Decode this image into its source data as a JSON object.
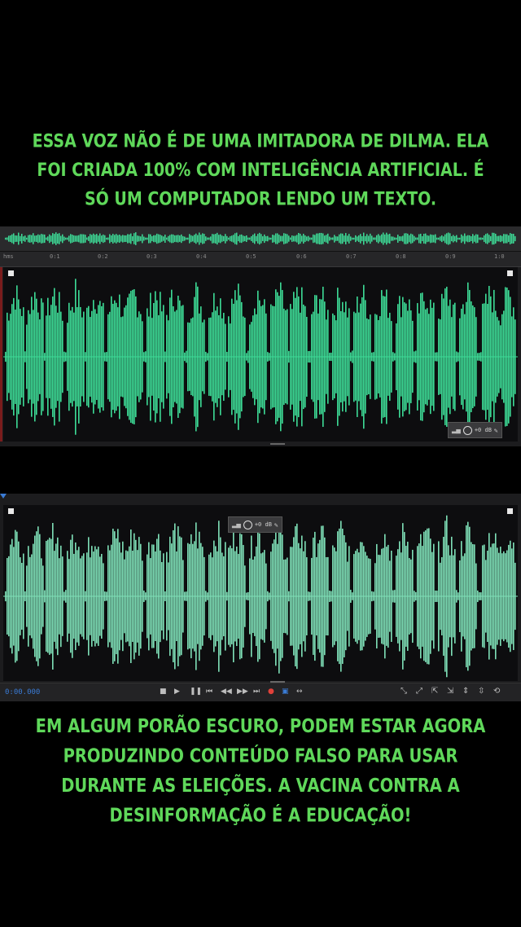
{
  "captions": {
    "top": [
      "ESSA VOZ NÃO É DE UMA IMITADORA DE DILMA. ELA",
      "FOI CRIADA 100% COM INTELIGÊNCIA ARTIFICIAL. É",
      "SÓ UM COMPUTADOR LENDO UM TEXTO."
    ],
    "bottom": [
      "EM ALGUM PORÃO ESCURO, PODEM ESTAR AGORA",
      "PRODUZINDO CONTEÚDO FALSO PARA USAR",
      "DURANTE AS ELEIÇÕES. A VACINA CONTRA A",
      "DESINFORMAÇÃO É A EDUCAÇÃO!"
    ]
  },
  "ruler_ticks": [
    "hms",
    "0:1",
    "0:2",
    "0:3",
    "0:4",
    "0:5",
    "0:6",
    "0:7",
    "0:8",
    "0:9",
    "1:0"
  ],
  "hud": {
    "level_label": "+0 dB"
  },
  "transport": {
    "timecode": "0:00.000"
  },
  "colors": {
    "caption": "#5fd85a",
    "wave_top": "#3ddc97",
    "wave_bottom": "#7fe0b8",
    "playhead": "#3a7bd5",
    "record": "#e0413a"
  },
  "icons": {
    "transport": [
      "stop-icon",
      "play-icon",
      "pause-icon",
      "skip-start-icon",
      "rewind-icon",
      "fast-forward-icon",
      "skip-end-icon",
      "record-icon",
      "loop-icon",
      "shuttle-icon"
    ],
    "tools": [
      "zoom-in-icon",
      "zoom-out-icon",
      "zoom-full-icon",
      "zoom-selection-icon",
      "zoom-vertical-in-icon",
      "zoom-vertical-out-icon",
      "zoom-reset-icon"
    ]
  }
}
